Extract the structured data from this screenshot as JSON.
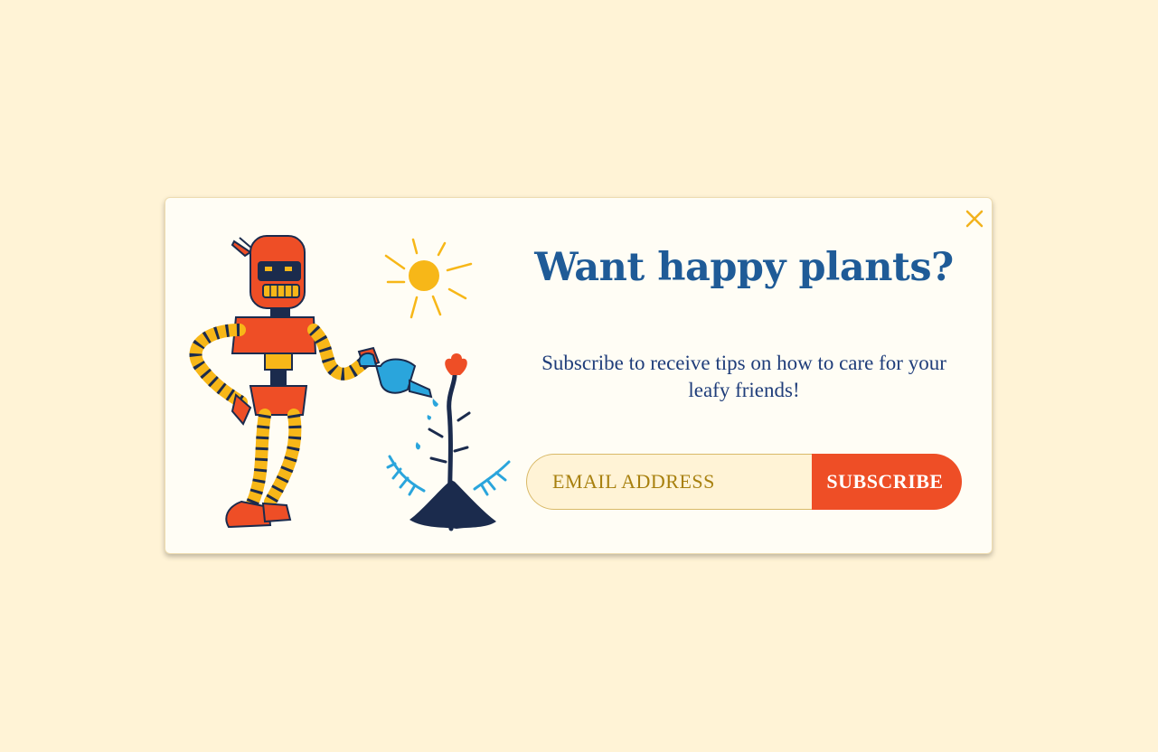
{
  "modal": {
    "title": "Want happy plants?",
    "subtitle": "Subscribe to receive tips on how to care for your leafy friends!",
    "email_placeholder": "EMAIL ADDRESS",
    "subscribe_label": "SUBSCRIBE",
    "close_icon": "close-icon"
  },
  "illustration": {
    "subject": "robot-watering-plant"
  },
  "colors": {
    "background": "#fff3d6",
    "modal_background": "#fffdf5",
    "title": "#1f5b97",
    "subtitle": "#1f3d7a",
    "accent": "#ee4e26",
    "input_text": "#a8800f",
    "close": "#f2b21c"
  }
}
